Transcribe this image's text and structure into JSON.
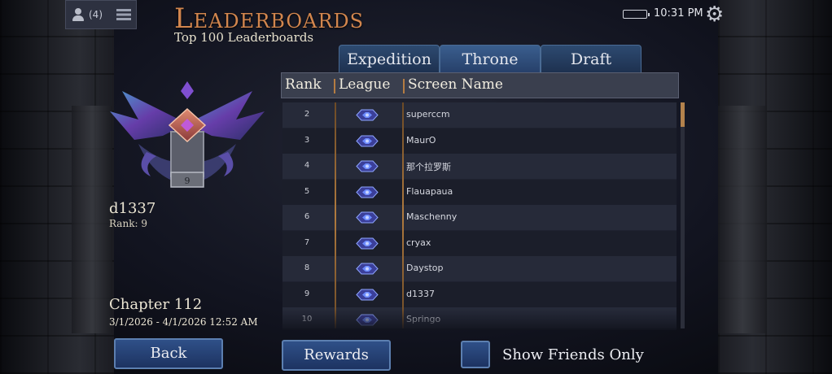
{
  "header": {
    "title": "Leaderboards",
    "subtitle": "Top 100 Leaderboards",
    "friends_count": "(4)"
  },
  "status_bar": {
    "time": "10:31 PM"
  },
  "tabs": [
    {
      "label": "Expedition",
      "active": false
    },
    {
      "label": "Throne",
      "active": true
    },
    {
      "label": "Draft",
      "active": false
    }
  ],
  "table": {
    "columns": [
      "Rank",
      "League",
      "Screen Name"
    ],
    "rows": [
      {
        "rank": "2",
        "name": "superccm"
      },
      {
        "rank": "3",
        "name": "MaurO"
      },
      {
        "rank": "4",
        "name": "那个拉罗斯"
      },
      {
        "rank": "5",
        "name": "Flauapaua"
      },
      {
        "rank": "6",
        "name": "Maschenny"
      },
      {
        "rank": "7",
        "name": "cryax"
      },
      {
        "rank": "8",
        "name": "Daystop"
      },
      {
        "rank": "9",
        "name": "d1337"
      },
      {
        "rank": "10",
        "name": "Springo"
      }
    ]
  },
  "player": {
    "name": "d1337",
    "rank_label": "Rank: 9",
    "emblem_number": "9",
    "chapter": "Chapter 112",
    "dates": "3/1/2026 - 4/1/2026 12:52 AM"
  },
  "buttons": {
    "back": "Back",
    "rewards": "Rewards",
    "show_friends": "Show Friends Only"
  },
  "colors": {
    "title": "#d2864e",
    "tab": "#2d4a70",
    "button": "#2f5088",
    "separator": "#b07a3e"
  }
}
